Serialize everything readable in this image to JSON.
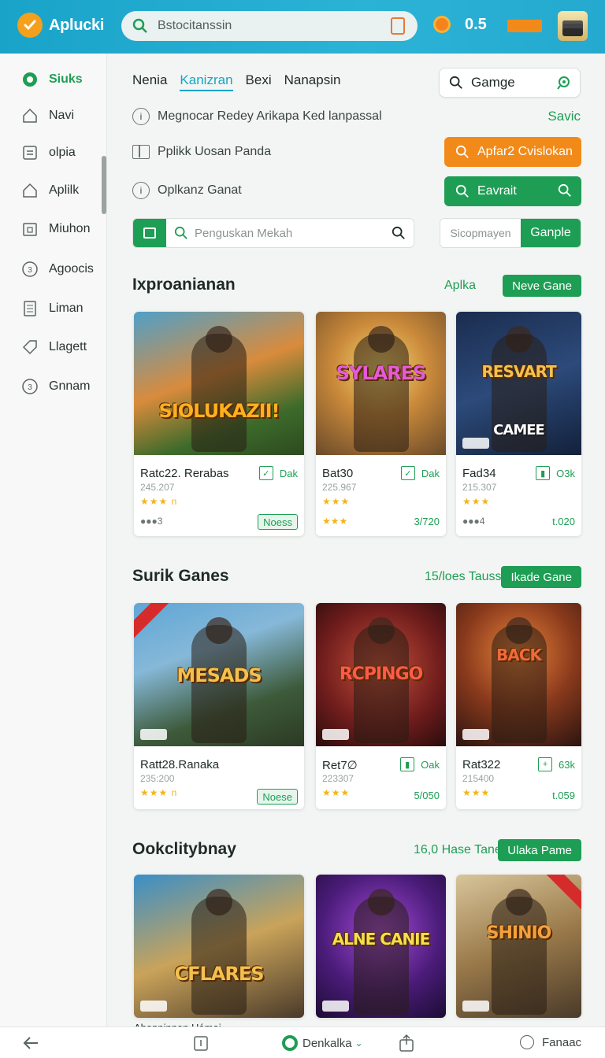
{
  "header": {
    "app_name": "Aplucki",
    "search_text": "Bstocitanssin",
    "score": "0.5"
  },
  "sidebar": {
    "items": [
      {
        "label": "Siuks",
        "icon": "compass-icon",
        "active": true
      },
      {
        "label": "Navi",
        "icon": "home-icon"
      },
      {
        "label": "olpia",
        "icon": "list-icon"
      },
      {
        "label": "Aplilk",
        "icon": "home-icon"
      },
      {
        "label": "Miuhon",
        "icon": "calendar-icon"
      },
      {
        "label": "Agoocis",
        "icon": "coin-icon"
      },
      {
        "label": "Liman",
        "icon": "document-icon"
      },
      {
        "label": "Llagett",
        "icon": "tag-icon"
      },
      {
        "label": "Gnnam",
        "icon": "coin-icon"
      }
    ]
  },
  "tabs": [
    "Nenia",
    "Kanizran",
    "Bexi",
    "Nanapsin"
  ],
  "active_tab": "Kanizran",
  "game_search": {
    "value": "Gamge"
  },
  "info_rows": [
    "Megnocar Redey Arikapa Ked lanpassal",
    "Pplikk Uosan Panda",
    "Oplkanz Ganat"
  ],
  "link_savic": "Savic",
  "buttons": {
    "orange": "Apfar2 Cvislokan",
    "green": "Eavrait",
    "split_left": "Sicopmayen",
    "split_right": "Ganple"
  },
  "long_search": {
    "placeholder": "Penguskan Mekah"
  },
  "sections": [
    {
      "title": "Ixproanianan",
      "meta": "Aplka",
      "button": "Neve Gane",
      "cards": [
        {
          "art_title": "SIOLUKAZII!",
          "title": "Ratc22. Rerabas",
          "sub": "245.207",
          "stars": "★★★ n",
          "dots": "●●●3",
          "ok": "Dak",
          "pill": "Noess",
          "num": ""
        },
        {
          "art_title": "SYLARES",
          "title": "Bat30",
          "sub": "225.967",
          "stars": "★★★",
          "dots": "★★★",
          "ok": "Dak",
          "pill": "",
          "num": "3/720"
        },
        {
          "art_title": "RESVART",
          "art_sub": "CAMEE",
          "title": "Fad34",
          "sub": "215.307",
          "stars": "★★★",
          "dots": "●●●4",
          "ok": "O3k",
          "pill": "",
          "num": "t.020"
        }
      ]
    },
    {
      "title": "Surik Ganes",
      "meta": "15/loes Tauss",
      "button": "Ikade Gane",
      "cards": [
        {
          "art_title": "MESADS",
          "title": "Ratt28.Ranaka",
          "sub": "235:200",
          "stars": "★★★ n",
          "dots": "",
          "ok": "",
          "pill": "Noese",
          "num": ""
        },
        {
          "art_title": "RCPINGO",
          "title": "Ret7∅",
          "sub": "223307",
          "stars": "★★★",
          "dots": "",
          "ok": "Oak",
          "pill": "",
          "num": "5/050"
        },
        {
          "art_title": "BACK",
          "title": "Rat322",
          "sub": "215400",
          "stars": "★★★",
          "dots": "",
          "ok": "63k",
          "pill": "",
          "num": "t.059"
        }
      ]
    },
    {
      "title": "Ookclitybnay",
      "meta": "16,0 Hase Tanen",
      "button": "Ulaka Pame",
      "cards": [
        {
          "art_title": "CFLARES"
        },
        {
          "art_title": "ALNE CANIE"
        },
        {
          "art_title": "SHINIO"
        }
      ]
    }
  ],
  "peek_text": "Ahanninnan Hámai",
  "bottombar": {
    "center": "Denkalka",
    "right": "Fanaac"
  }
}
